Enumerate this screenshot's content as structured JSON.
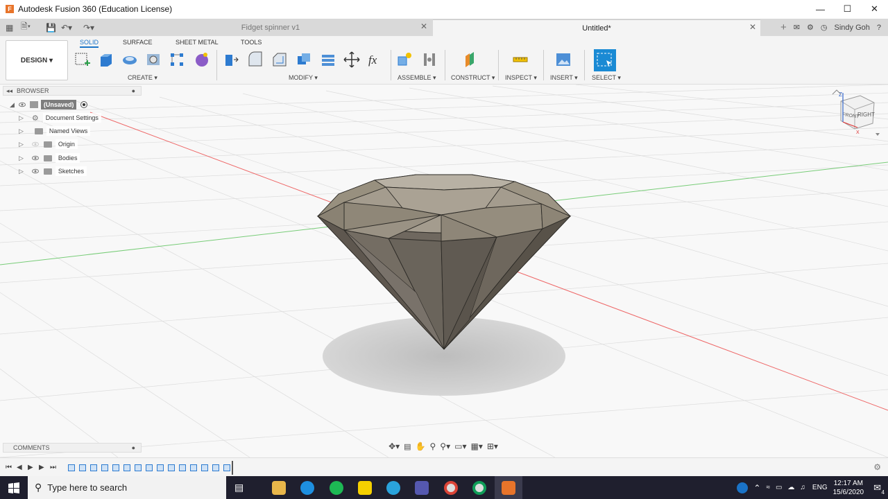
{
  "window": {
    "title": "Autodesk Fusion 360 (Education License)",
    "logo_letter": "F"
  },
  "tabs": {
    "inactive": {
      "label": "Fidget spinner v1"
    },
    "active": {
      "label": "Untitled*"
    },
    "user": "Sindy Goh"
  },
  "toolbar": {
    "workspace": "DESIGN ▾",
    "workspace_tabs": [
      "SOLID",
      "SURFACE",
      "SHEET METAL",
      "TOOLS"
    ],
    "groups": {
      "create": "CREATE ▾",
      "modify": "MODIFY ▾",
      "assemble": "ASSEMBLE ▾",
      "construct": "CONSTRUCT ▾",
      "inspect": "INSPECT ▾",
      "insert": "INSERT ▾",
      "select": "SELECT ▾"
    },
    "fx_label": "fx"
  },
  "browser": {
    "title": "BROWSER",
    "root": "(Unsaved)",
    "items": [
      "Document Settings",
      "Named Views",
      "Origin",
      "Bodies",
      "Sketches"
    ]
  },
  "comments": {
    "title": "COMMENTS"
  },
  "viewcube": {
    "front": "FRONT",
    "right": "RIGHT",
    "axis_z": "Z",
    "axis_x": "X"
  },
  "taskbar": {
    "search_placeholder": "Type here to search",
    "language": "ENG",
    "time": "12:17 AM",
    "date": "15/6/2020",
    "notification_count": "4"
  },
  "colors": {
    "accent": "#1a73c7",
    "select_button": "#1a8ad4",
    "diamond_fill": "#8c8478",
    "taskbar": "#1f1f2e"
  }
}
